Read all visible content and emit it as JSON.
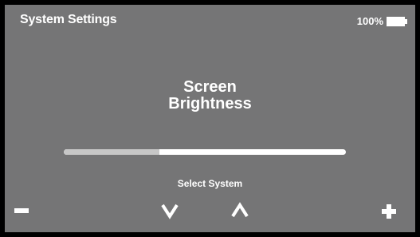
{
  "header": {
    "title": "System Settings",
    "battery": {
      "level_text": "100%",
      "icon": "battery-icon",
      "fill_fraction": 1.0
    }
  },
  "main": {
    "heading_line1": "Screen",
    "heading_line2": "Brightness",
    "brightness_slider": {
      "value_fraction": 0.34
    },
    "select_label": "Select System"
  },
  "controls": {
    "decrease": {
      "icon": "minus-icon"
    },
    "down": {
      "icon": "chevron-down-icon"
    },
    "up": {
      "icon": "chevron-up-icon"
    },
    "increase": {
      "icon": "plus-icon"
    }
  },
  "colors": {
    "screen_background": "#757576",
    "frame": "#000000",
    "text": "#ffffff",
    "slider_track": "#ffffff",
    "slider_fill": "#c7c7c7"
  }
}
